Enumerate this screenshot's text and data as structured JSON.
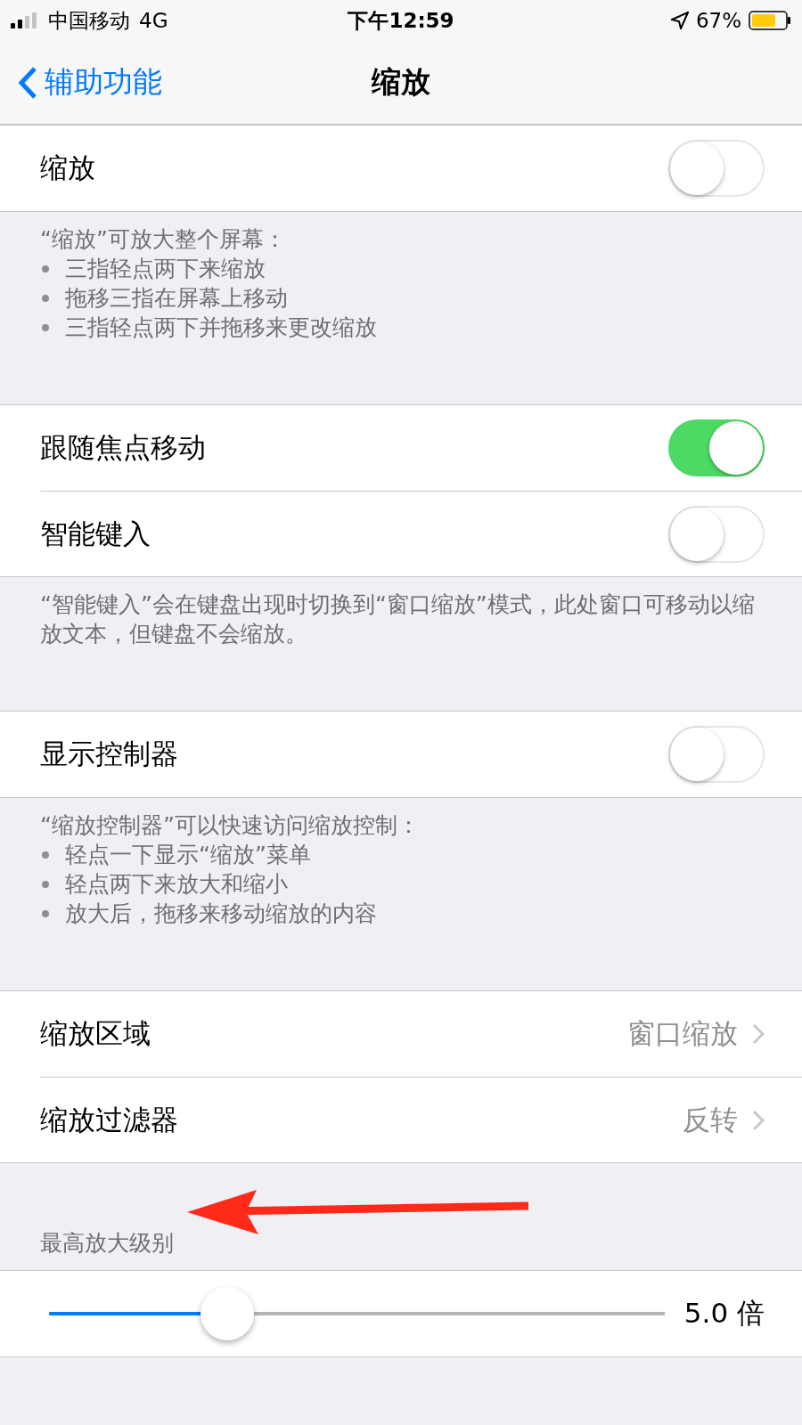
{
  "status_bar": {
    "carrier": "中国移动",
    "network": "4G",
    "time": "下午12:59",
    "battery": "67%"
  },
  "nav": {
    "back": "辅助功能",
    "title": "缩放"
  },
  "sections": [
    {
      "rows": [
        {
          "kind": "toggle",
          "label": "缩放",
          "on": false
        }
      ],
      "footer": {
        "text": "“缩放”可放大整个屏幕：",
        "bullets": [
          "三指轻点两下来缩放",
          "拖移三指在屏幕上移动",
          "三指轻点两下并拖移来更改缩放"
        ]
      }
    },
    {
      "rows": [
        {
          "kind": "toggle",
          "label": "跟随焦点移动",
          "on": true
        },
        {
          "kind": "toggle",
          "label": "智能键入",
          "on": false
        }
      ],
      "footer": {
        "text": "“智能键入”会在键盘出现时切换到“窗口缩放”模式，此处窗口可移动以缩放文本，但键盘不会缩放。"
      }
    },
    {
      "rows": [
        {
          "kind": "toggle",
          "label": "显示控制器",
          "on": false
        }
      ],
      "footer": {
        "text": "“缩放控制器”可以快速访问缩放控制：",
        "bullets": [
          "轻点一下显示“缩放”菜单",
          "轻点两下来放大和缩小",
          "放大后，拖移来移动缩放的内容"
        ]
      }
    },
    {
      "rows": [
        {
          "kind": "link",
          "label": "缩放区域",
          "value": "窗口缩放"
        },
        {
          "kind": "link",
          "label": "缩放过滤器",
          "value": "反转"
        }
      ]
    },
    {
      "header": "最高放大级别",
      "arrow_annotation": true,
      "rows": [
        {
          "kind": "slider",
          "level": 0.29,
          "value": "5.0 倍"
        }
      ]
    }
  ]
}
